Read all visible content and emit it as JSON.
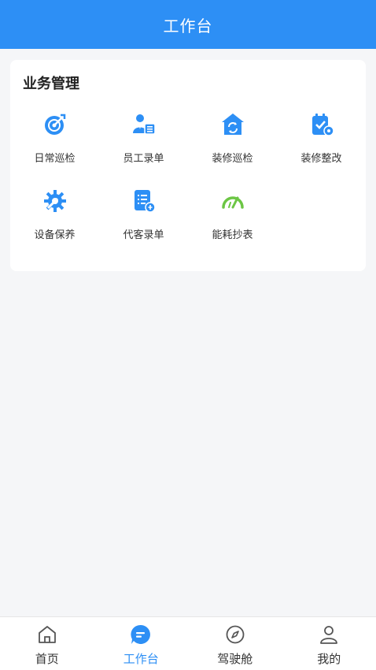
{
  "header": {
    "title": "工作台"
  },
  "section": {
    "title": "业务管理",
    "items": [
      {
        "label": "日常巡检",
        "icon": "target-check-icon"
      },
      {
        "label": "员工录单",
        "icon": "employee-form-icon"
      },
      {
        "label": "装修巡检",
        "icon": "house-refresh-icon"
      },
      {
        "label": "装修整改",
        "icon": "clipboard-gear-icon"
      },
      {
        "label": "设备保养",
        "icon": "gear-wrench-icon"
      },
      {
        "label": "代客录单",
        "icon": "document-list-icon"
      },
      {
        "label": "能耗抄表",
        "icon": "gauge-meter-icon"
      }
    ]
  },
  "tabbar": {
    "items": [
      {
        "label": "首页",
        "icon": "home-icon",
        "active": false
      },
      {
        "label": "工作台",
        "icon": "chat-bubble-icon",
        "active": true
      },
      {
        "label": "驾驶舱",
        "icon": "compass-icon",
        "active": false
      },
      {
        "label": "我的",
        "icon": "user-icon",
        "active": false
      }
    ]
  },
  "colors": {
    "primary": "#2d8ff5",
    "accent_green": "#6cc644",
    "background": "#f5f6f8"
  }
}
